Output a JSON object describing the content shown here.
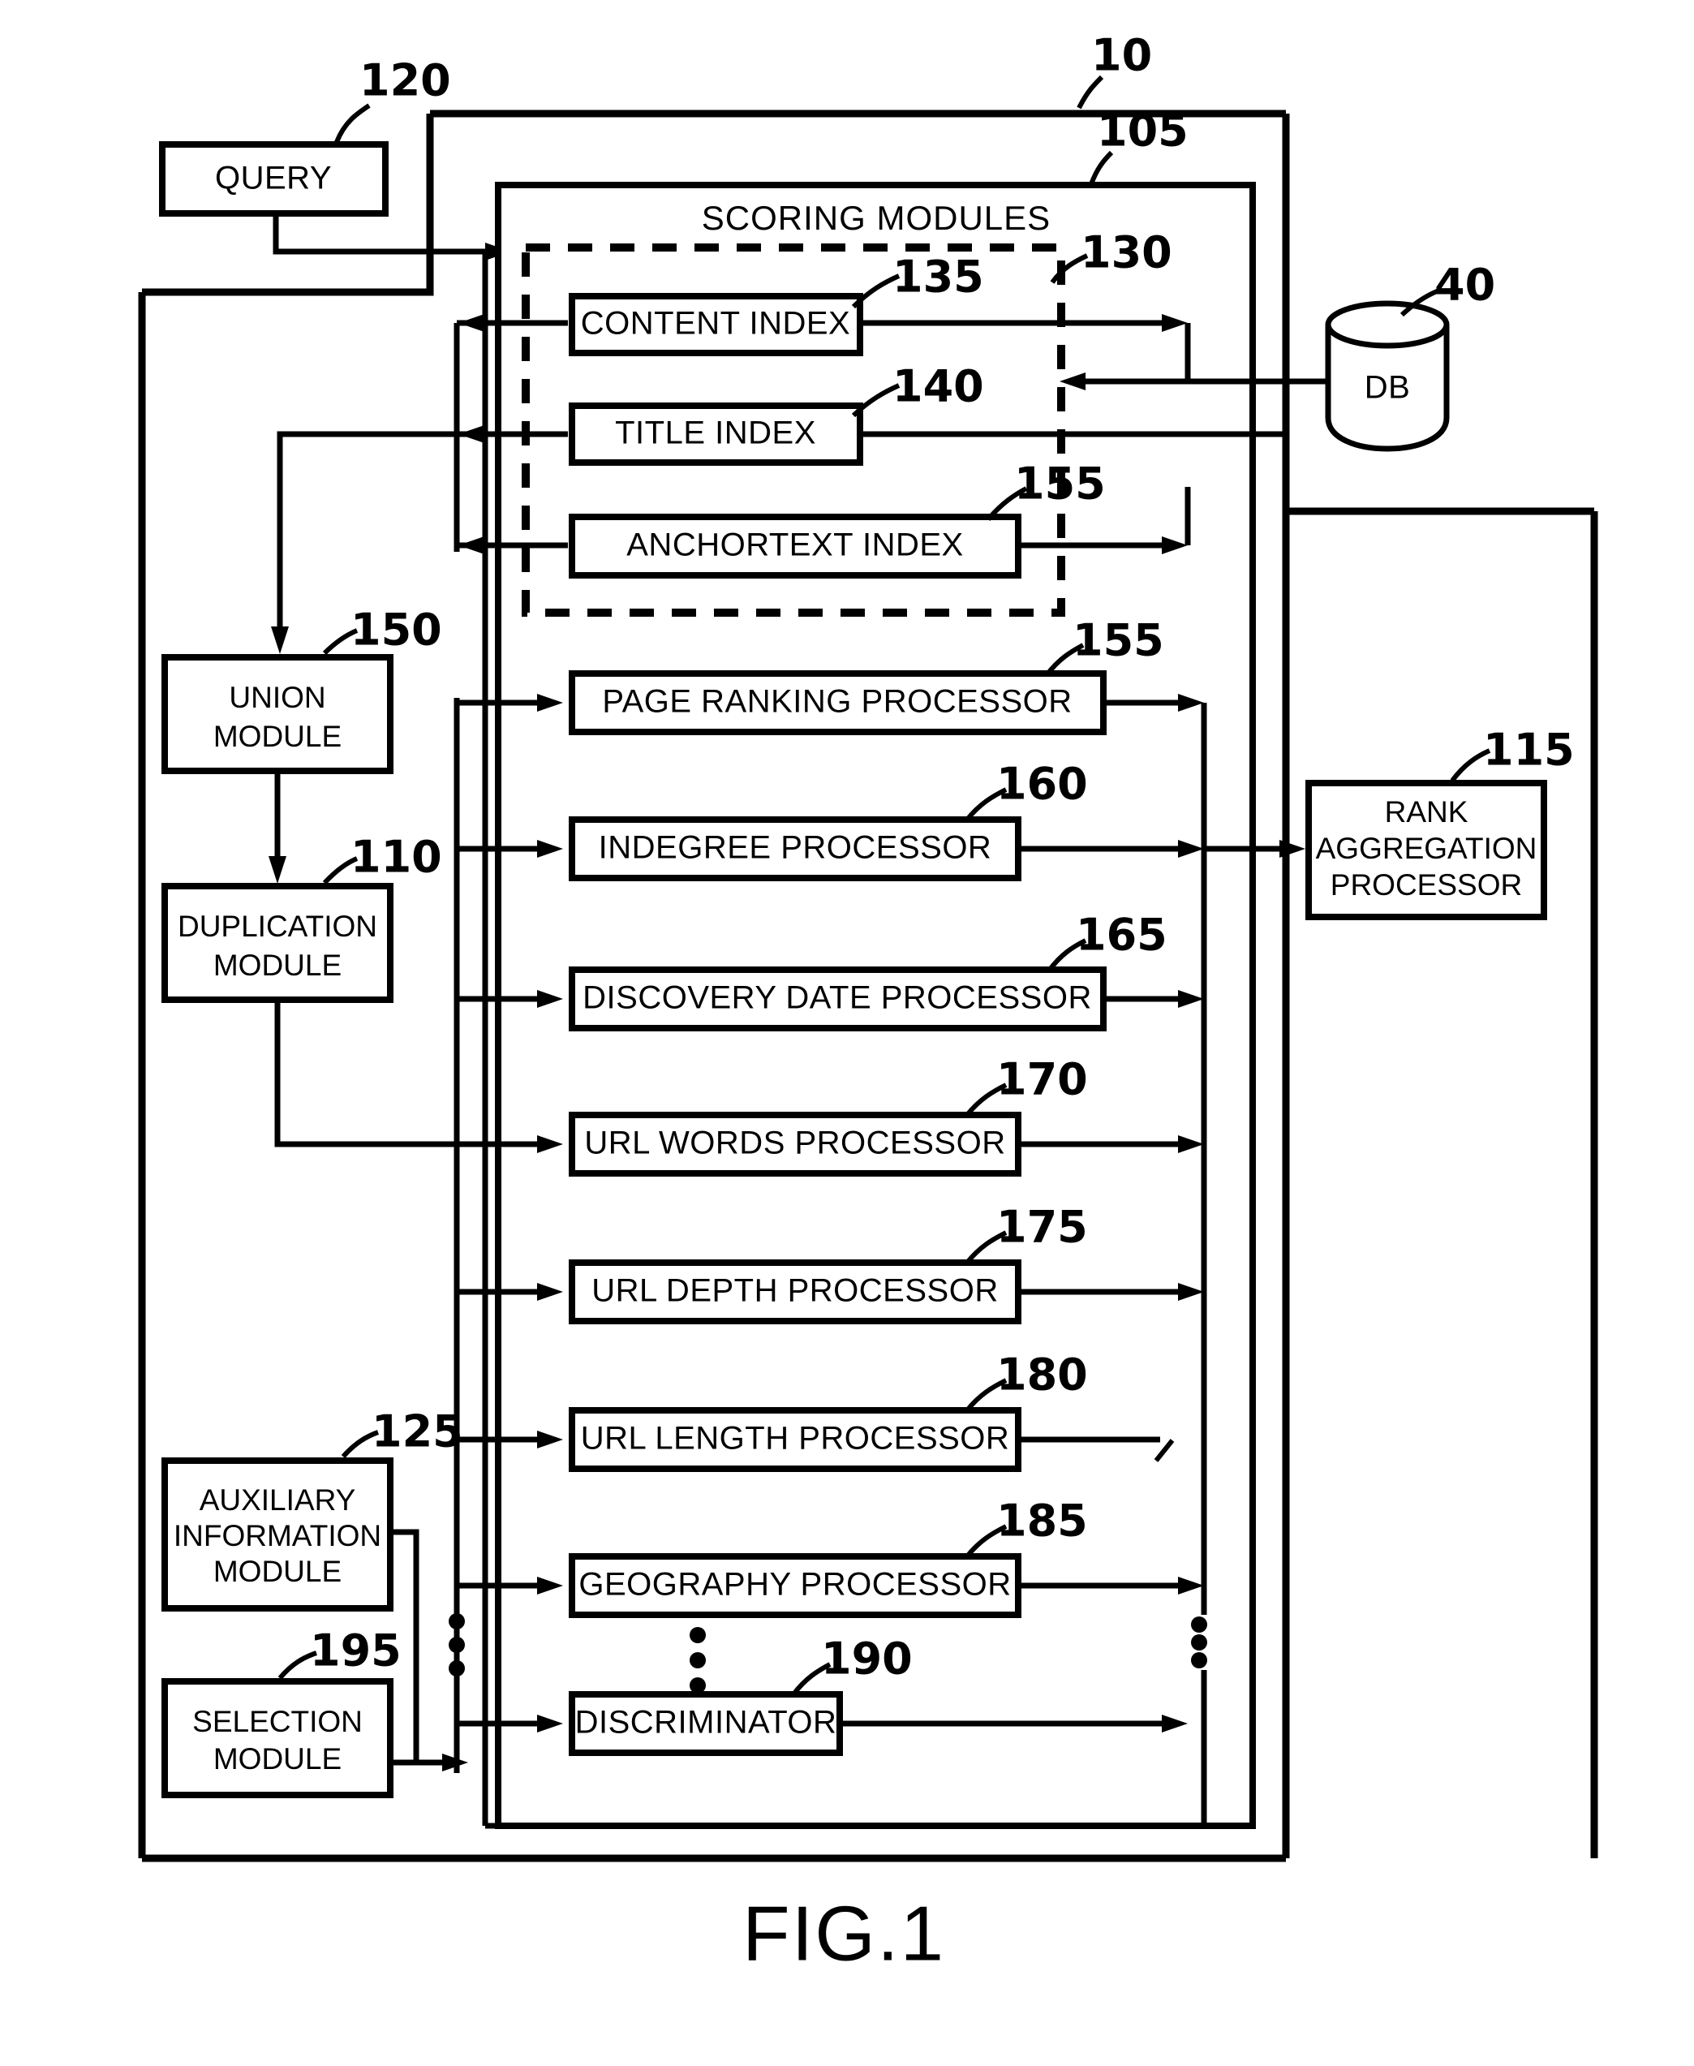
{
  "figure": {
    "caption": "FIG.1",
    "system_ref": "10",
    "scoring_modules_title": "SCORING MODULES",
    "scoring_modules_ref": "105",
    "index_group_ref": "130",
    "database_label": "DB",
    "database_ref": "40"
  },
  "boxes": {
    "query": {
      "label": "QUERY",
      "ref": "120"
    },
    "content": {
      "label": "CONTENT INDEX",
      "ref": "135"
    },
    "title": {
      "label": "TITLE INDEX",
      "ref": "140"
    },
    "anchortext": {
      "label": "ANCHORTEXT INDEX",
      "ref": "155"
    },
    "union": {
      "line1": "UNION",
      "line2": "MODULE",
      "ref": "150"
    },
    "duplication": {
      "line1": "DUPLICATION",
      "line2": "MODULE",
      "ref": "110"
    },
    "auxiliary": {
      "line1": "AUXILIARY",
      "line2": "INFORMATION",
      "line3": "MODULE",
      "ref": "125"
    },
    "selection": {
      "line1": "SELECTION",
      "line2": "MODULE",
      "ref": "195"
    },
    "pagerank": {
      "label": "PAGE RANKING PROCESSOR",
      "ref": "155"
    },
    "indegree": {
      "label": "INDEGREE PROCESSOR",
      "ref": "160"
    },
    "discovery": {
      "label": "DISCOVERY DATE PROCESSOR",
      "ref": "165"
    },
    "urlwords": {
      "label": "URL WORDS PROCESSOR",
      "ref": "170"
    },
    "urldepth": {
      "label": "URL DEPTH PROCESSOR",
      "ref": "175"
    },
    "urllength": {
      "label": "URL LENGTH PROCESSOR",
      "ref": "180"
    },
    "geography": {
      "label": "GEOGRAPHY PROCESSOR",
      "ref": "185"
    },
    "discriminator": {
      "label": "DISCRIMINATOR",
      "ref": "190"
    },
    "rankagg": {
      "line1": "RANK",
      "line2": "AGGREGATION",
      "line3": "PROCESSOR",
      "ref": "115"
    }
  }
}
